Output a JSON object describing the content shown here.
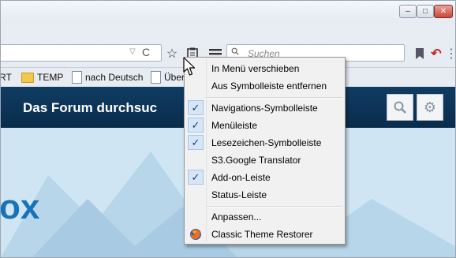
{
  "titlebar": {
    "minimize": "‒",
    "maximize": "□",
    "close": "✕"
  },
  "address_bar": {
    "dropdown": "▽",
    "reload": "C"
  },
  "toolbar": {
    "bookmark_star": "☆",
    "clipboard": "📋",
    "menu": "≡"
  },
  "search": {
    "placeholder": "Suchen"
  },
  "bookmarks": [
    {
      "label": "RT",
      "type": "text"
    },
    {
      "label": "TEMP",
      "type": "folder"
    },
    {
      "label": "nach Deutsch",
      "type": "page"
    },
    {
      "label": "Über",
      "type": "page"
    }
  ],
  "forum": {
    "title": "Das Forum durchsuc"
  },
  "background_text": "ox",
  "context_menu": {
    "items": [
      {
        "label": "In Menü verschieben",
        "checked": false
      },
      {
        "label": "Aus Symbolleiste entfernen",
        "checked": false
      },
      {
        "label": "Navigations-Symbolleiste",
        "checked": true
      },
      {
        "label": "Menüleiste",
        "checked": true
      },
      {
        "label": "Lesezeichen-Symbolleiste",
        "checked": true
      },
      {
        "label": "S3.Google Translator",
        "checked": false
      },
      {
        "label": "Add-on-Leiste",
        "checked": true
      },
      {
        "label": "Status-Leiste",
        "checked": false
      },
      {
        "label": "Anpassen...",
        "checked": false
      },
      {
        "label": "Classic Theme Restorer",
        "checked": false,
        "icon": "firefox-icon"
      }
    ]
  },
  "colors": {
    "header_bg": "#0b3355",
    "menu_bg": "#f1f1f1",
    "check_color": "#1b3c7a",
    "accent_blue": "#1773b9"
  }
}
